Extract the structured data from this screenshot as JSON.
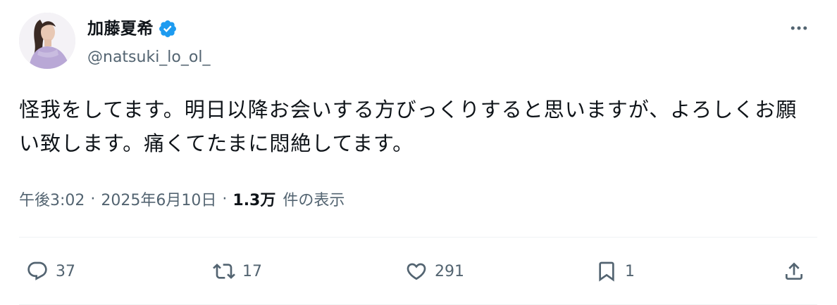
{
  "user": {
    "display_name": "加藤夏希",
    "handle": "@natsuki_lo_ol_",
    "verified": true
  },
  "post": {
    "text": "怪我をしてます。明日以降お会いする方びっくりすると思いますが、よろしくお願い致します。痛くてたまに悶絶してます。",
    "time": "午後3:02",
    "separator": "·",
    "date": "2025年6月10日",
    "views_count": "1.3万",
    "views_label": "件の表示"
  },
  "actions": {
    "reply_count": "37",
    "retweet_count": "17",
    "like_count": "291",
    "bookmark_count": "1"
  },
  "icons": {
    "verified": "verified-badge-icon",
    "more": "more-dots-icon",
    "reply": "reply-icon",
    "retweet": "retweet-icon",
    "like": "heart-icon",
    "bookmark": "bookmark-icon",
    "share": "share-icon"
  },
  "colors": {
    "text_primary": "#0f1419",
    "text_secondary": "#536471",
    "verified_blue": "#1d9bf0",
    "divider": "#eff3f4"
  }
}
